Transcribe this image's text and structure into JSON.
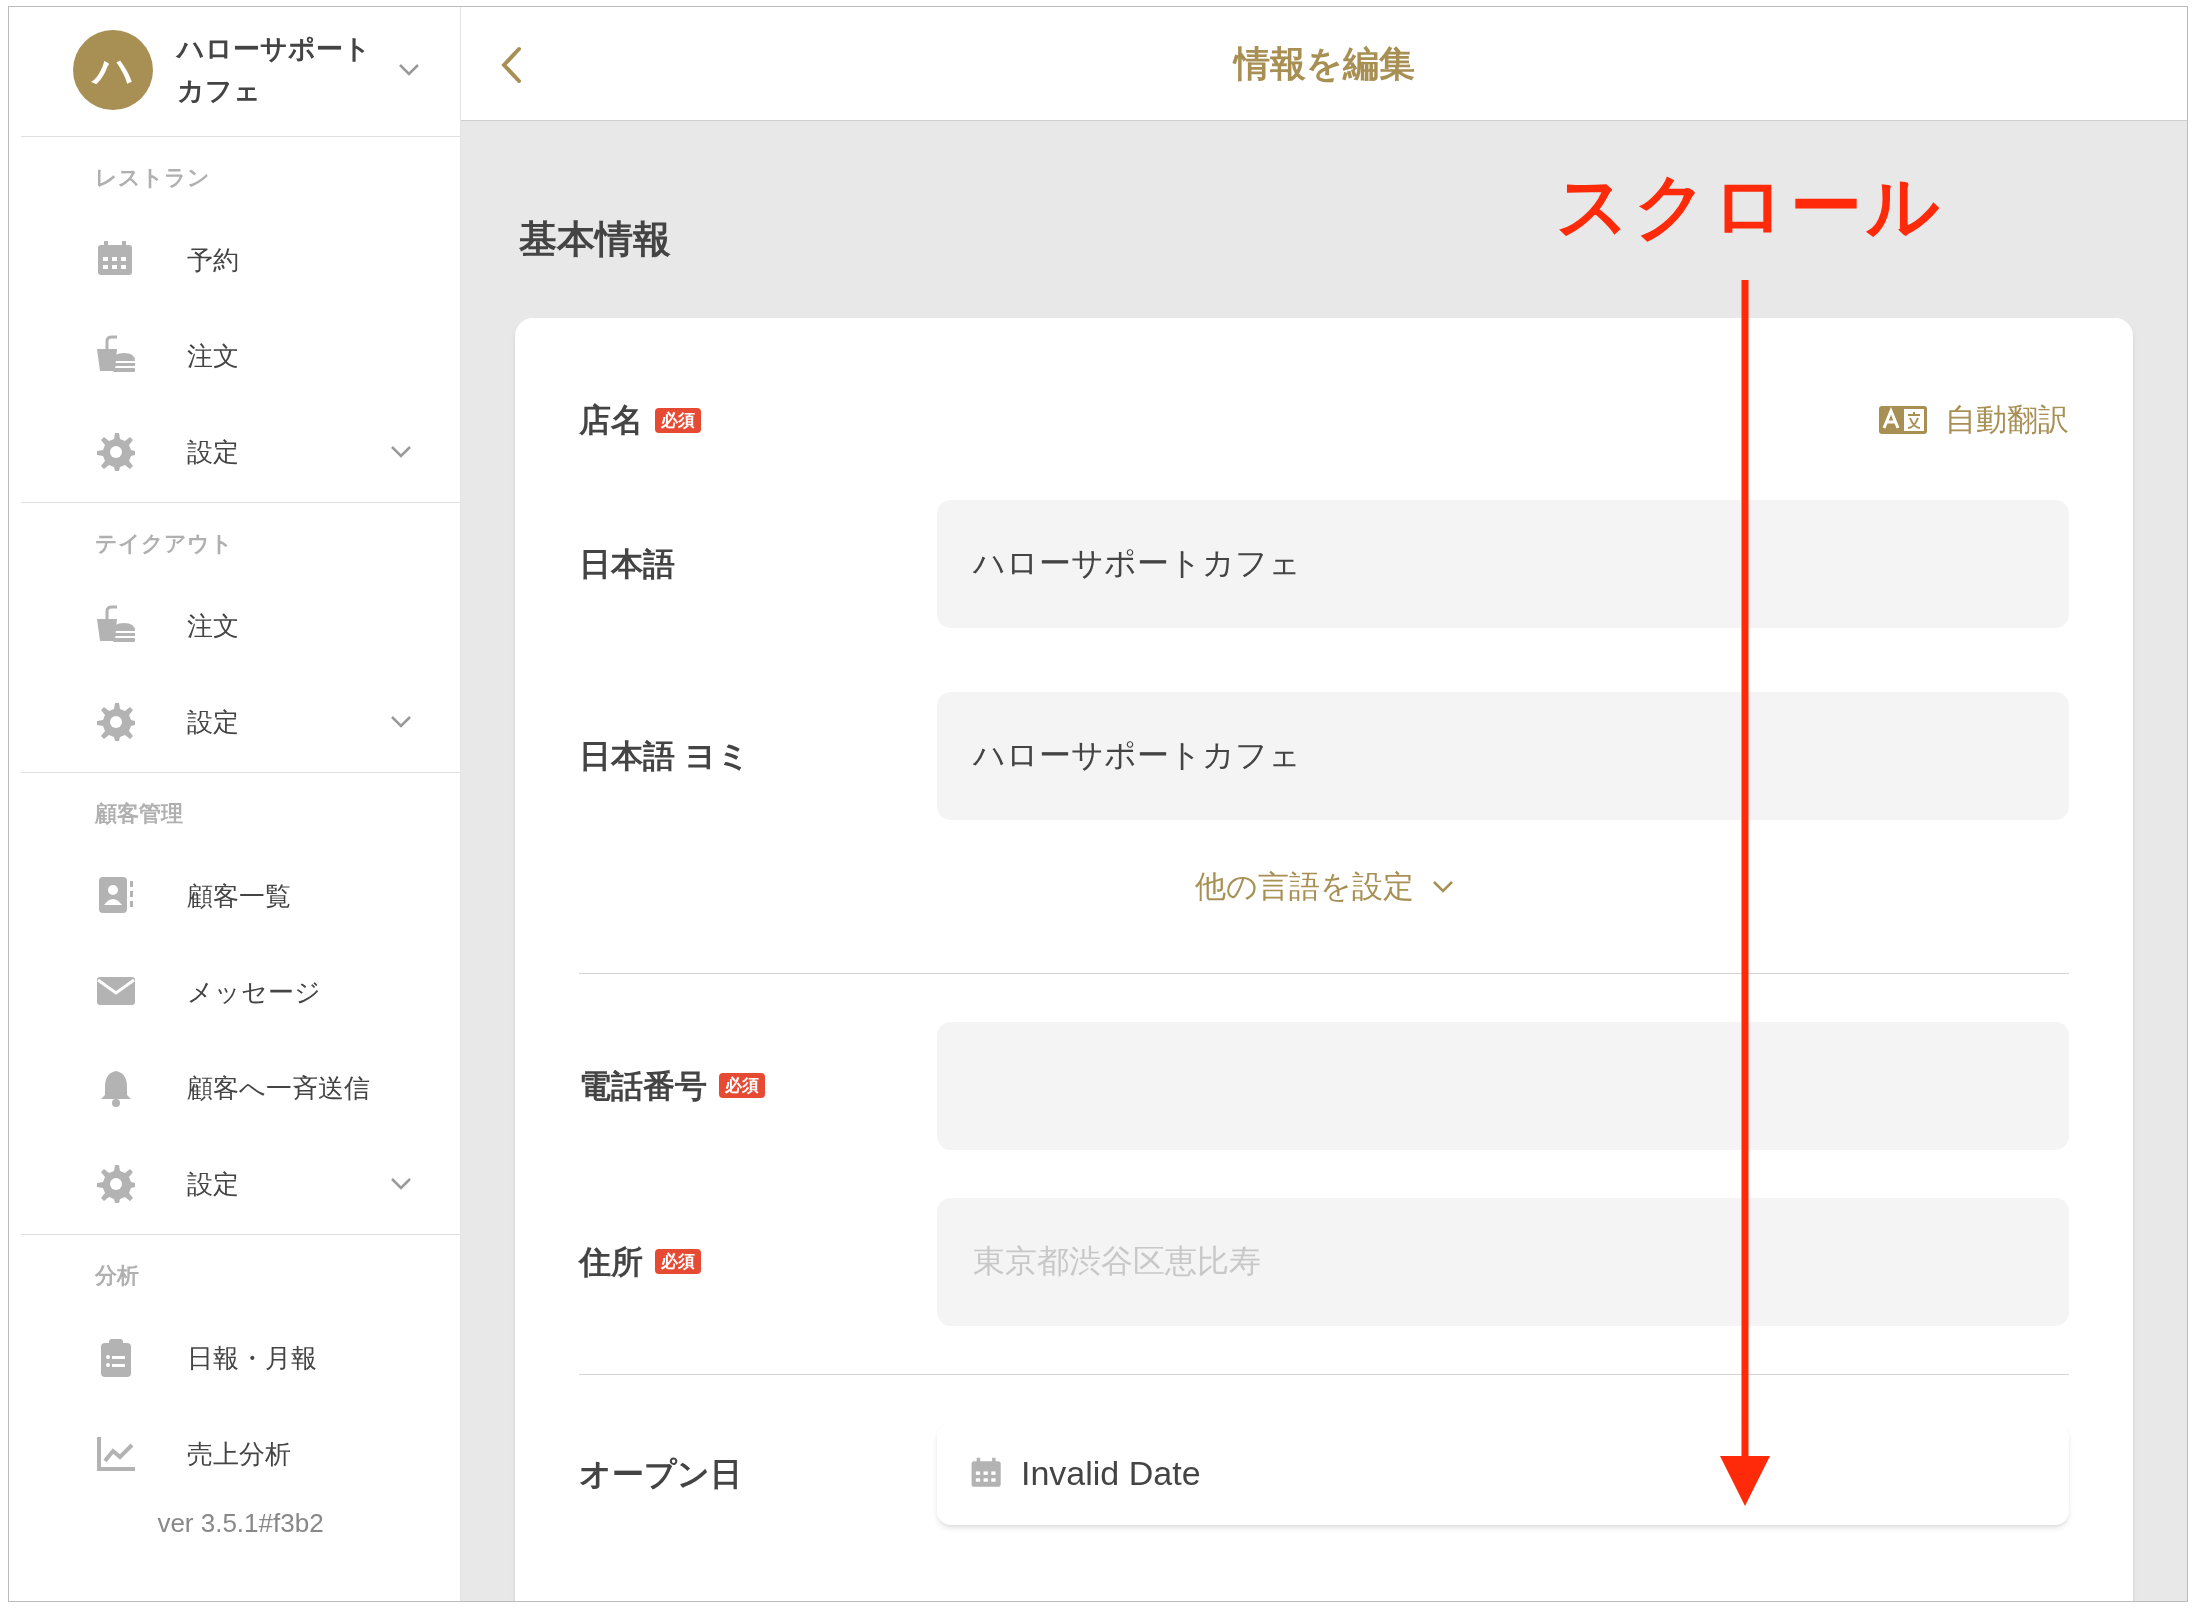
{
  "store": {
    "initial": "ハ",
    "name": "ハローサポートカフェ"
  },
  "sidebar": {
    "sections": [
      {
        "title": "レストラン",
        "items": [
          {
            "kind": "calendar",
            "label": "予約",
            "expandable": false
          },
          {
            "kind": "food",
            "label": "注文",
            "expandable": false
          },
          {
            "kind": "gear",
            "label": "設定",
            "expandable": true
          }
        ]
      },
      {
        "title": "テイクアウト",
        "items": [
          {
            "kind": "food",
            "label": "注文",
            "expandable": false
          },
          {
            "kind": "gear",
            "label": "設定",
            "expandable": true
          }
        ]
      },
      {
        "title": "顧客管理",
        "items": [
          {
            "kind": "contact",
            "label": "顧客一覧",
            "expandable": false
          },
          {
            "kind": "mail",
            "label": "メッセージ",
            "expandable": false
          },
          {
            "kind": "bell",
            "label": "顧客へ一斉送信",
            "expandable": false
          },
          {
            "kind": "gear",
            "label": "設定",
            "expandable": true
          }
        ]
      },
      {
        "title": "分析",
        "items": [
          {
            "kind": "clipboard",
            "label": "日報・月報",
            "expandable": false
          },
          {
            "kind": "chart",
            "label": "売上分析",
            "expandable": false
          }
        ]
      }
    ],
    "version": "ver 3.5.1#f3b2"
  },
  "header": {
    "title": "情報を編集"
  },
  "section_title": "基本情報",
  "form": {
    "name_label": "店名",
    "name_badge": "必須",
    "translate": "自動翻訳",
    "name_fields": [
      {
        "label": "日本語",
        "value": "ハローサポートカフェ"
      },
      {
        "label": "日本語 ヨミ",
        "value": "ハローサポートカフェ"
      }
    ],
    "other_languages": "他の言語を設定",
    "contact_fields": [
      {
        "label": "電話番号",
        "badge": "必須"
      },
      {
        "label": "住所",
        "badge": "必須",
        "placeholder": "東京都渋谷区恵比寿"
      }
    ],
    "open_date": {
      "label": "オープン日",
      "value": "Invalid Date"
    }
  },
  "annotation": {
    "label": "スクロール"
  }
}
